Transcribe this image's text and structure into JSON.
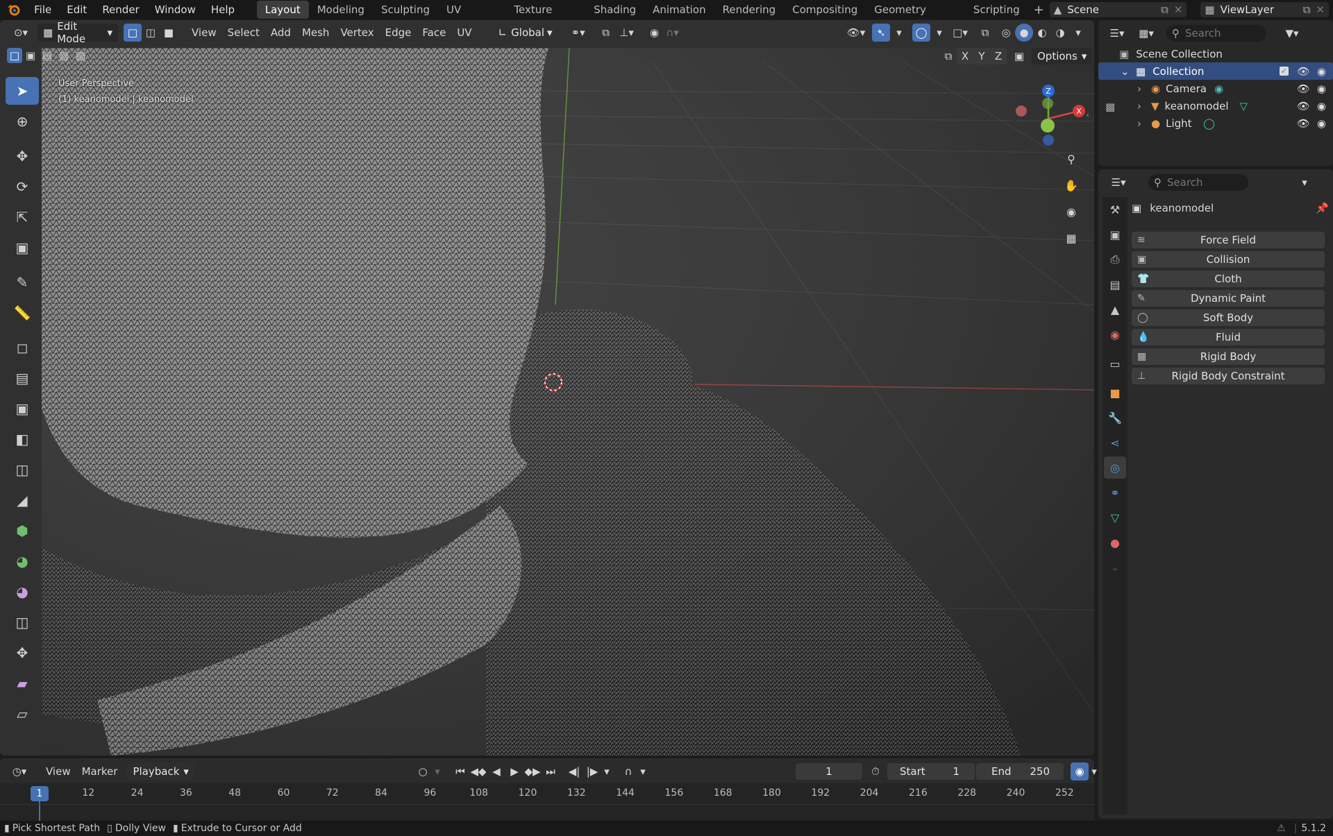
{
  "menubar": {
    "logo_icon": "blender-logo-icon",
    "menus": [
      "File",
      "Edit",
      "Render",
      "Window",
      "Help"
    ],
    "workspaces": [
      "Layout",
      "Modeling",
      "Sculpting",
      "UV Editing",
      "Texture Paint",
      "Shading",
      "Animation",
      "Rendering",
      "Compositing",
      "Geometry Nodes",
      "Scripting"
    ],
    "active_workspace": "Layout",
    "scene": "Scene",
    "view_layer": "ViewLayer"
  },
  "viewport": {
    "mode": "Edit Mode",
    "menus": [
      "View",
      "Select",
      "Add",
      "Mesh",
      "Vertex",
      "Edge",
      "Face",
      "UV"
    ],
    "orientation": "Global",
    "options_label": "Options",
    "axes": [
      "X",
      "Y",
      "Z"
    ],
    "overlay_line1": "User Perspective",
    "overlay_line2": "(1) keanomodel | keanomodel",
    "gizmo": {
      "x": "X",
      "y": "Y",
      "z": "Z"
    },
    "accent": "#4772b3"
  },
  "timeline": {
    "menus": [
      "View",
      "Marker",
      "Playback"
    ],
    "current_frame": "1",
    "start_label": "Start",
    "start": "1",
    "end_label": "End",
    "end": "250",
    "ticks": [
      "12",
      "24",
      "36",
      "48",
      "60",
      "72",
      "84",
      "96",
      "108",
      "120",
      "132",
      "144",
      "156",
      "168",
      "180",
      "192",
      "204",
      "216",
      "228",
      "240",
      "252"
    ],
    "playhead": "1"
  },
  "statusbar": {
    "hints": [
      "Pick Shortest Path",
      "Dolly View",
      "Extrude to Cursor or Add"
    ],
    "version": "5.1.2"
  },
  "outliner": {
    "search_placeholder": "Search",
    "root": "Scene Collection",
    "collection": "Collection",
    "items": [
      {
        "name": "Camera",
        "icon": "camera-icon"
      },
      {
        "name": "keanomodel",
        "icon": "mesh-icon"
      },
      {
        "name": "Light",
        "icon": "light-icon"
      }
    ]
  },
  "properties": {
    "search_placeholder": "Search",
    "object_name": "keanomodel",
    "physics_buttons": [
      "Force Field",
      "Collision",
      "Cloth",
      "Dynamic Paint",
      "Soft Body",
      "Fluid",
      "Rigid Body",
      "Rigid Body Constraint"
    ]
  }
}
